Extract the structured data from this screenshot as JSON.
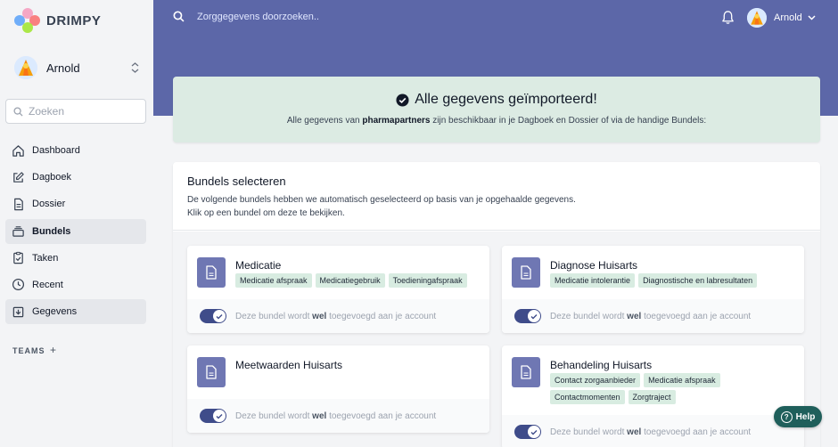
{
  "app": {
    "name": "DRIMPY"
  },
  "sidebar": {
    "user_name": "Arnold",
    "search_placeholder": "Zoeken",
    "items": [
      {
        "label": "Dashboard",
        "icon": "home-icon",
        "active": false
      },
      {
        "label": "Dagboek",
        "icon": "pencil-square-icon",
        "active": false
      },
      {
        "label": "Dossier",
        "icon": "document-icon",
        "active": false
      },
      {
        "label": "Bundels",
        "icon": "stack-icon",
        "active": true
      },
      {
        "label": "Taken",
        "icon": "clipboard-check-icon",
        "active": false
      },
      {
        "label": "Recent",
        "icon": "clock-icon",
        "active": false
      },
      {
        "label": "Gegevens",
        "icon": "download-icon",
        "active": true
      }
    ],
    "teams_label": "TEAMS",
    "teams_add": "+"
  },
  "topbar": {
    "search_placeholder": "Zorggegevens doorzoeken..",
    "user_name": "Arnold"
  },
  "banner": {
    "title": "Alle gegevens geïmporteerd!",
    "sub_before": "Alle gegevens van ",
    "sub_bold": "pharmapartners",
    "sub_after": " zijn beschikbaar in je Dagboek en Dossier of via de handige Bundels:"
  },
  "panel": {
    "title": "Bundels selecteren",
    "desc_line1": "De volgende bundels hebben we automatisch geselecteerd op basis van je opgehaalde gegevens.",
    "desc_line2": "Klik op een bundel om deze te bekijken."
  },
  "cards": [
    {
      "title": "Medicatie",
      "tags": [
        "Medicatie afspraak",
        "Medicatiegebruik",
        "Toedieningafspraak"
      ],
      "toggle_on": true
    },
    {
      "title": "Diagnose Huisarts",
      "tags": [
        "Medicatie intolerantie",
        "Diagnostische en labresultaten"
      ],
      "toggle_on": true
    },
    {
      "title": "Meetwaarden Huisarts",
      "tags": [],
      "toggle_on": true
    },
    {
      "title": "Behandeling Huisarts",
      "tags": [
        "Contact zorgaanbieder",
        "Medicatie afspraak",
        "Contactmomenten",
        "Zorgtraject"
      ],
      "toggle_on": true
    }
  ],
  "card_status": {
    "before": "Deze bundel wordt ",
    "bold": "wel",
    "after": " toegevoegd aan je account"
  },
  "help": {
    "label": "Help"
  },
  "colors": {
    "topbar": "#5c67a8",
    "banner": "#dcebe3",
    "tag": "#d8ece1",
    "toggle": "#3f4c8a",
    "help": "#1f5f5b"
  }
}
